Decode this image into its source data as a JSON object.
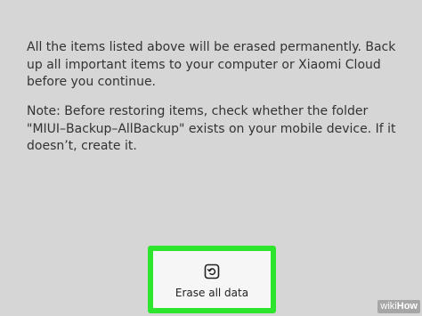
{
  "message": {
    "warning": "All the items listed above will be erased permanently. Back up all important items to your computer or Xiaomi Cloud before you continue.",
    "note": "Note: Before restoring items, check whether the folder \"MIUI–Backup–AllBackup\" exists on your mobile device. If it doesn’t, create it."
  },
  "action": {
    "erase_label": "Erase all data",
    "icon": "reset-icon",
    "highlight_color": "#2ee52e"
  },
  "watermark": {
    "wiki": "wiki",
    "how": "How"
  }
}
